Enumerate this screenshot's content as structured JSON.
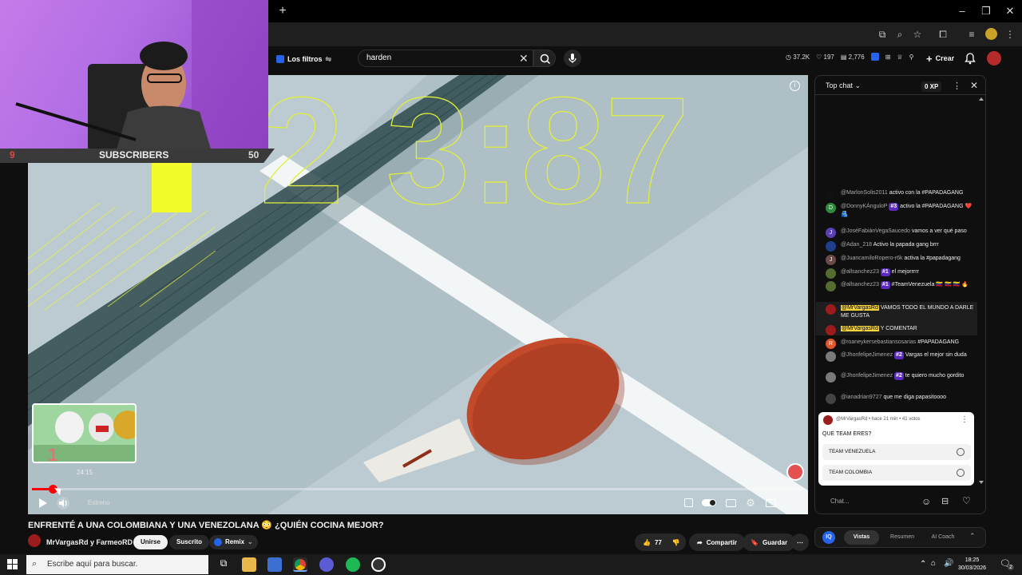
{
  "browser": {
    "new_tab": "+",
    "window_controls": [
      "–",
      "❐",
      "✕"
    ]
  },
  "header": {
    "filters_label": "Los filtros",
    "search_value": "harden",
    "search_clear": "✕",
    "stats": [
      "37.2K",
      "197",
      "2,776"
    ],
    "create_label": "Crear"
  },
  "video": {
    "overlay": {
      "sub_left": "9",
      "sub_label": "SUBSCRIBERS",
      "sub_right": "50"
    },
    "preview_time": "24:15",
    "preview_number": "1",
    "progress_fraction": 0.027,
    "premiere_label": "Estreno",
    "info_icon": "i"
  },
  "meta": {
    "title": "ENFRENTÉ A UNA COLOMBIANA Y UNA VENEZOLANA 😳 ¿QUIÉN COCINA MEJOR?",
    "channel": "MrVargasRd y FarmeoRD",
    "join_label": "Unirse",
    "subscribe_label": "Suscrito",
    "remix_label": "Remix",
    "likes": "77",
    "share_label": "Compartir",
    "save_label": "Guardar",
    "more": "⋯"
  },
  "chat": {
    "mode": "Top chat",
    "xp": "0 XP",
    "messages": [
      {
        "author": "@MarlonSolis2011",
        "text": "activo con la #PAPADAGANG",
        "initial": "",
        "color": "#111111",
        "badge": ""
      },
      {
        "author": "@DonnyKÁnguloP",
        "text": "activo la #PAPADAGANG ❤️ 🫂",
        "initial": "D",
        "color": "#2e8b3e",
        "badge": "#3"
      },
      {
        "author": "@JoséFabiánVegaSaucedo",
        "text": "vamos a ver qué paso",
        "initial": "J",
        "color": "#5b3fb0",
        "badge": ""
      },
      {
        "author": "@Adan_218",
        "text": "Activo la papada gang brrr",
        "initial": "",
        "color": "#1f3f8a",
        "badge": ""
      },
      {
        "author": "@JuancamiloRopero-r6k",
        "text": "activa la #papadagang",
        "initial": "J",
        "color": "#6b4a4a",
        "badge": ""
      },
      {
        "author": "@allsanchez23",
        "text": "el mejorrrrr",
        "initial": "",
        "color": "#556b2f",
        "badge": "#1"
      },
      {
        "author": "@allsanchez23",
        "text": "#TeamVenezuela 🇻🇪 🇻🇪 🇻🇪 🔥",
        "initial": "",
        "color": "#556b2f",
        "badge": "#1"
      },
      {
        "author": "@MrVargasRd",
        "text": "VAMOS TODO EL MUNDO A DARLE ME GUSTA",
        "initial": "",
        "color": "#9b1c1c",
        "badge": "",
        "mod": true
      },
      {
        "author": "@MrVargasRd",
        "text": "Y COMENTAR",
        "initial": "",
        "color": "#9b1c1c",
        "badge": "",
        "mod": true
      },
      {
        "author": "@roaneykersebastiansosarias",
        "text": "#PAPADAGANG",
        "initial": "R",
        "color": "#e0552b",
        "badge": ""
      },
      {
        "author": "@JhonfelipeJimenez",
        "text": "Vargas el mejor sin duda",
        "initial": "",
        "color": "#7a7a7a",
        "badge": "#2"
      },
      {
        "author": "@JhonfelipeJimenez",
        "text": "te quiero mucho gordito",
        "initial": "",
        "color": "#7a7a7a",
        "badge": "#2"
      },
      {
        "author": "@ianadrian9727",
        "text": "que me diga papasitoooo",
        "initial": "",
        "color": "#444444",
        "badge": ""
      }
    ],
    "poll": {
      "meta": "@MrVargasRd • hace 21 min • 41 votos",
      "question": "QUE TEAM ERES?",
      "options": [
        "TEAM VENEZUELA",
        "TEAM COLOMBIA"
      ]
    },
    "input_placeholder": "Chat..."
  },
  "side_tabs": [
    "Vistas",
    "Resumen",
    "AI Coach"
  ],
  "taskbar": {
    "search_placeholder": "Escribe aquí para buscar.",
    "time": "18:25",
    "date": "30/03/2026",
    "notif_count": "2"
  },
  "colors": {
    "accent": "#ff0000",
    "poll_bg": "#ffffff",
    "overlay_yellow": "#f4fb2b"
  }
}
